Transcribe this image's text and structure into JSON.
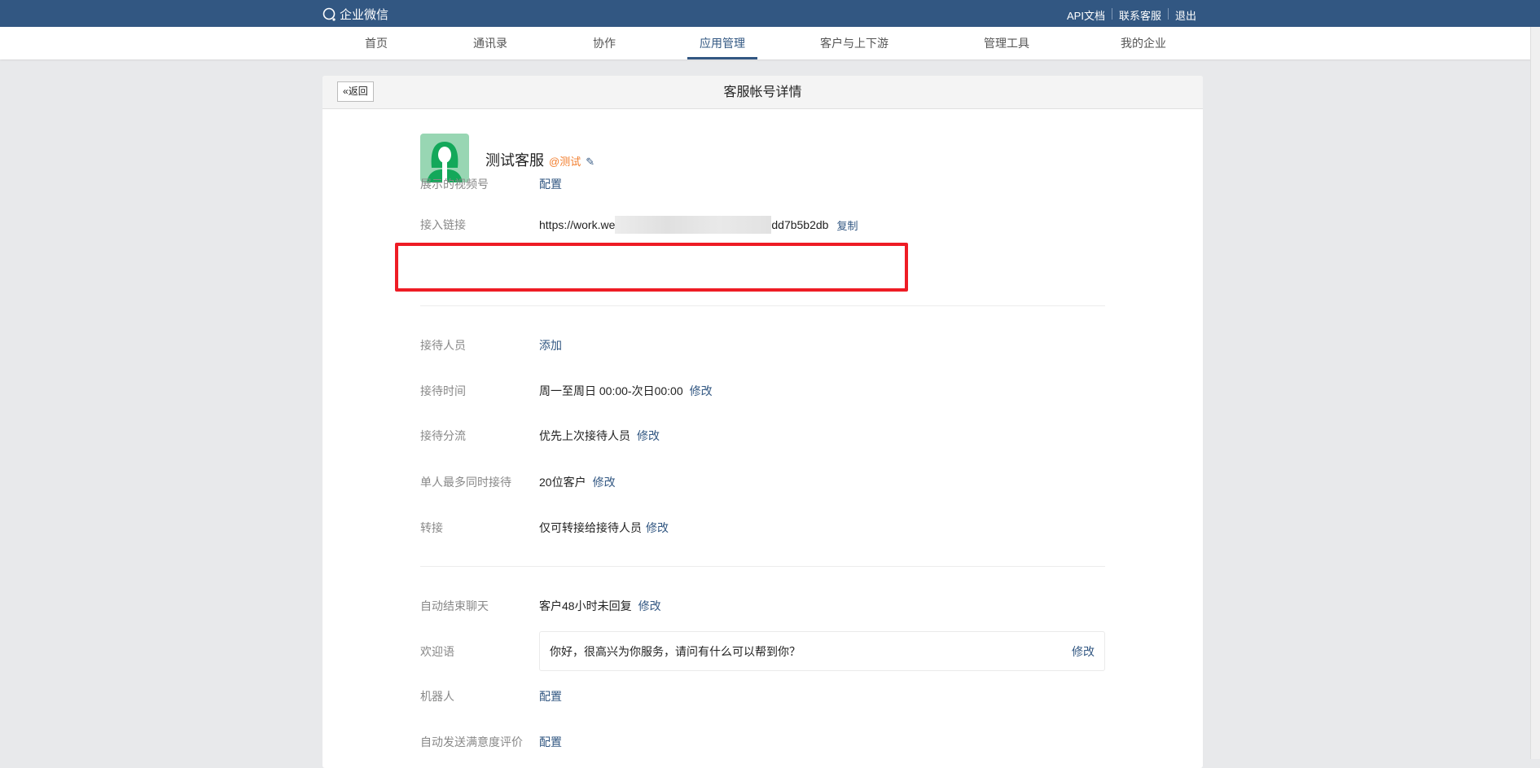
{
  "topbar": {
    "logo": "企业微信",
    "links": [
      "API文档",
      "联系客服",
      "退出"
    ]
  },
  "nav": {
    "items": [
      "首页",
      "通讯录",
      "协作",
      "应用管理",
      "客户与上下游",
      "管理工具",
      "我的企业"
    ],
    "active": "应用管理"
  },
  "card": {
    "back_label": "返回",
    "title": "客服帐号详情"
  },
  "account": {
    "name": "测试客服",
    "tag": "@测试"
  },
  "rows": {
    "video": {
      "label": "展示的视频号",
      "link": "配置"
    },
    "link": {
      "label": "接入链接",
      "prefix": "https://work.we",
      "suffix": "dd7b5b2db",
      "copy": "复制"
    },
    "staff": {
      "label": "接待人员",
      "link": "添加"
    },
    "time": {
      "label": "接待时间",
      "value": "周一至周日 00:00-次日00:00",
      "link": "修改"
    },
    "split": {
      "label": "接待分流",
      "value": "优先上次接待人员",
      "link": "修改"
    },
    "max": {
      "label": "单人最多同时接待",
      "value": "20位客户",
      "link": "修改"
    },
    "transfer": {
      "label": "转接",
      "value": "仅可转接给接待人员",
      "link": "修改"
    },
    "autoend": {
      "label": "自动结束聊天",
      "value": "客户48小时未回复",
      "link": "修改"
    },
    "welcome": {
      "label": "欢迎语",
      "value": "你好，很高兴为你服务，请问有什么可以帮到你？",
      "link": "修改"
    },
    "robot": {
      "label": "机器人",
      "link": "配置"
    },
    "rating": {
      "label": "自动发送满意度评价",
      "link": "配置"
    }
  },
  "colors": {
    "brand": "#325782",
    "highlight": "#ee1c25",
    "tag": "#f27d2c"
  }
}
